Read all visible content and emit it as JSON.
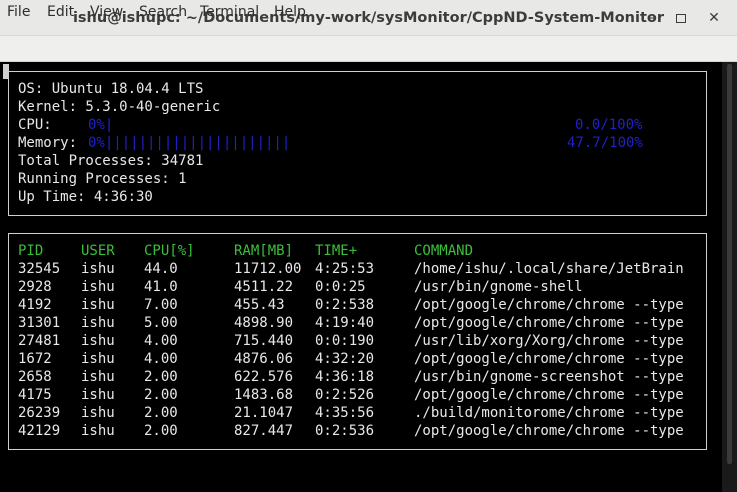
{
  "window": {
    "title": "ishu@ishupc: ~/Documents/my-work/sysMonitor/CppND-System-Monitor",
    "minimize_glyph": "–",
    "close_glyph": "✕"
  },
  "menu": [
    "File",
    "Edit",
    "View",
    "Search",
    "Terminal",
    "Help"
  ],
  "system": {
    "os": "OS: Ubuntu 18.04.4 LTS",
    "kernel": "Kernel: 5.3.0-40-generic",
    "cpu_label": "CPU:",
    "cpu_bar": "0%|",
    "cpu_value": "0.0/100%",
    "cpu_percent": 0.0,
    "memory_label": "Memory:",
    "memory_bar": "0%||||||||||||||||||||||",
    "memory_value": "47.7/100%",
    "memory_percent": 47.7,
    "total_processes": "Total Processes: 34781",
    "running_processes": "Running Processes: 1",
    "up_time": "Up Time: 4:36:30"
  },
  "process_table": {
    "columns": [
      "PID",
      "USER",
      "CPU[%]",
      "RAM[MB]",
      "TIME+",
      "COMMAND"
    ],
    "rows": [
      [
        "32545",
        "ishu",
        "44.0",
        "11712.00",
        "4:25:53",
        "/home/ishu/.local/share/JetBrain"
      ],
      [
        "2928",
        "ishu",
        "41.0",
        "4511.22",
        "0:0:25",
        "/usr/bin/gnome-shell"
      ],
      [
        "4192",
        "ishu",
        "7.00",
        "455.43",
        "0:2:538",
        "/opt/google/chrome/chrome --type"
      ],
      [
        "31301",
        "ishu",
        "5.00",
        "4898.90",
        "4:19:40",
        "/opt/google/chrome/chrome --type"
      ],
      [
        "27481",
        "ishu",
        "4.00",
        "715.440",
        "0:0:190",
        "/usr/lib/xorg/Xorg/chrome --type"
      ],
      [
        "1672",
        "ishu",
        "4.00",
        "4876.06",
        "4:32:20",
        "/opt/google/chrome/chrome --type"
      ],
      [
        "2658",
        "ishu",
        "2.00",
        "622.576",
        "4:36:18",
        "/usr/bin/gnome-screenshot --type"
      ],
      [
        "4175",
        "ishu",
        "2.00",
        "1483.68",
        "0:2:526",
        "/opt/google/chrome/chrome --type"
      ],
      [
        "26239",
        "ishu",
        "2.00",
        "21.1047",
        "4:35:56",
        "./build/monitorome/chrome --type"
      ],
      [
        "42129",
        "ishu",
        "2.00",
        "827.447",
        "0:2:536",
        "/opt/google/chrome/chrome --type"
      ]
    ]
  },
  "colors": {
    "terminal_bg": "#000000",
    "text": "#e8e8e8",
    "header_green": "#3bbf3b",
    "bar_blue": "#2020c8",
    "box_border": "#cfcfcf"
  }
}
